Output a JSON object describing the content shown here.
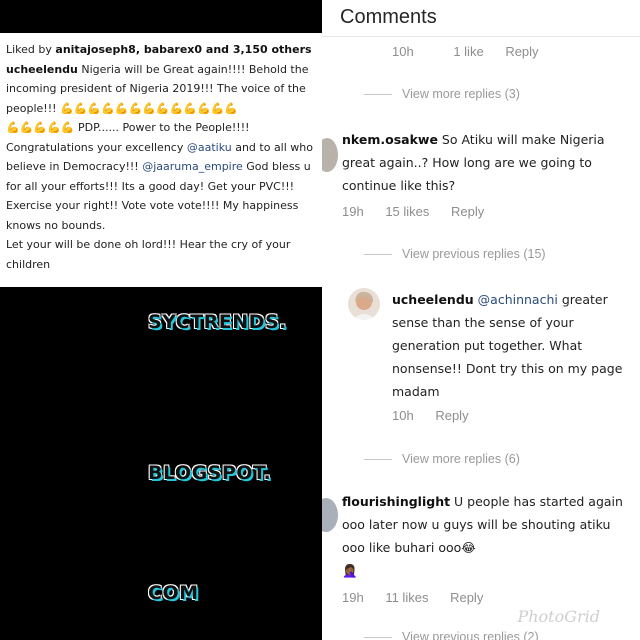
{
  "post": {
    "liked_by_prefix": "Liked by ",
    "liker1": "anitajoseph8",
    "liker_sep": ", ",
    "liker2": "babarex0",
    "likes_suffix": " and 3,150 others",
    "author": "ucheelendu",
    "caption_part1": " Nigeria will be Great again!!!! Behold the incoming president of Nigeria 2019!!! The voice of the people!!! ",
    "flex_emoji_line1": "💪💪💪💪💪💪💪💪💪💪💪💪💪",
    "flex_emoji_line2": "💪💪💪💪💪",
    "caption_part2": " PDP...... Power to the People!!!! Congratulations your excellency ",
    "mention1": "@aatiku",
    "caption_part3": " and to all who believe in Democracy!!! ",
    "mention2": "@jaaruma_empire",
    "caption_part4": " God bless u for all your efforts!!! Its a good day! Get your PVC!!! Exercise your right!! Vote vote vote!!!! My happiness knows no bounds.",
    "caption_part5": "Let your will be done oh lord!!! Hear the cry of your children"
  },
  "stamps": {
    "line1": "SYCTRENDS.",
    "line2": "BLOGSPOT.",
    "line3": "COM"
  },
  "comments_header": {
    "title": "Comments"
  },
  "comments": {
    "top_meta": {
      "time": "10h",
      "likes": "1 like",
      "reply": "Reply"
    },
    "view_more_1": "View more replies (3)",
    "c1": {
      "user": "nkem.osakwe",
      "text": " So Atiku will make Nigeria great again..? How long are we going to continue like this?",
      "time": "19h",
      "likes": "15 likes",
      "reply": "Reply"
    },
    "view_previous_1": "View previous replies (15)",
    "c2": {
      "user": "ucheelendu",
      "mention": "@achinnachi",
      "text": " greater sense than the sense of your generation put together.  What nonsense!! Dont try this on my page madam",
      "time": "10h",
      "reply": "Reply"
    },
    "view_more_2": "View more replies (6)",
    "c3": {
      "user": "flourishinglight",
      "text": " U people has started again ooo later now u guys will be shouting atiku ooo like buhari ooo",
      "emoji1": "😂",
      "emoji2": "🤦🏾‍♀️",
      "time": "19h",
      "likes": "11 likes",
      "reply": "Reply"
    },
    "view_previous_2": "View previous replies (2)"
  },
  "watermark": "PhotoGrid"
}
